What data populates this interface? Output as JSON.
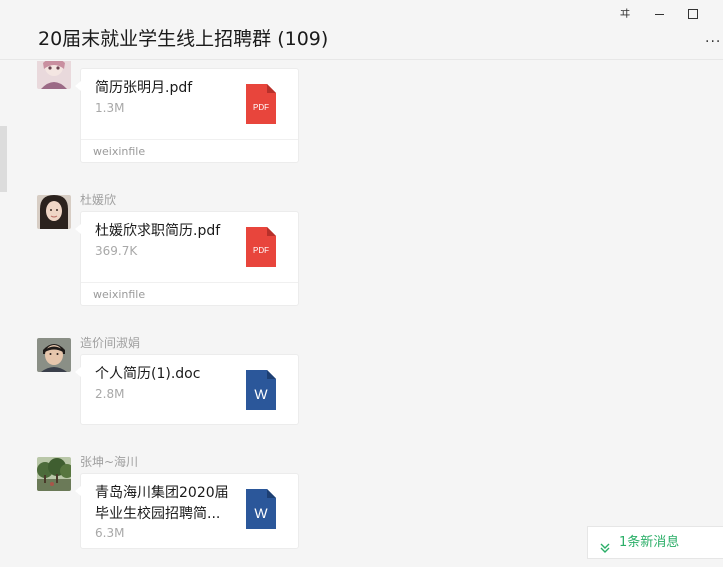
{
  "window": {
    "title": "20届末就业学生线上招聘群 (109)",
    "pin_label": "ヰ",
    "more_label": "..."
  },
  "messages": [
    {
      "sender": "",
      "file": {
        "name": "简历张明月.pdf",
        "size": "1.3M",
        "type": "pdf",
        "icon_label": "PDF",
        "source": "weixinfile"
      }
    },
    {
      "sender": "杜媛欣",
      "file": {
        "name": "杜媛欣求职简历.pdf",
        "size": "369.7K",
        "type": "pdf",
        "icon_label": "PDF",
        "source": "weixinfile"
      }
    },
    {
      "sender": "造价间淑娟",
      "file": {
        "name": "个人简历(1).doc",
        "size": "2.8M",
        "type": "word",
        "icon_label": "W",
        "source": ""
      }
    },
    {
      "sender": "张坤~海川",
      "file": {
        "name": "青岛海川集团2020届毕业生校园招聘简...",
        "size": "6.3M",
        "type": "word",
        "icon_label": "W",
        "source": ""
      }
    }
  ],
  "new_message_banner": {
    "label": "1条新消息"
  },
  "colors": {
    "pdf_red": "#e8453c",
    "word_blue": "#2b579a",
    "accent_green": "#2aae67",
    "background": "#f5f5f5"
  }
}
